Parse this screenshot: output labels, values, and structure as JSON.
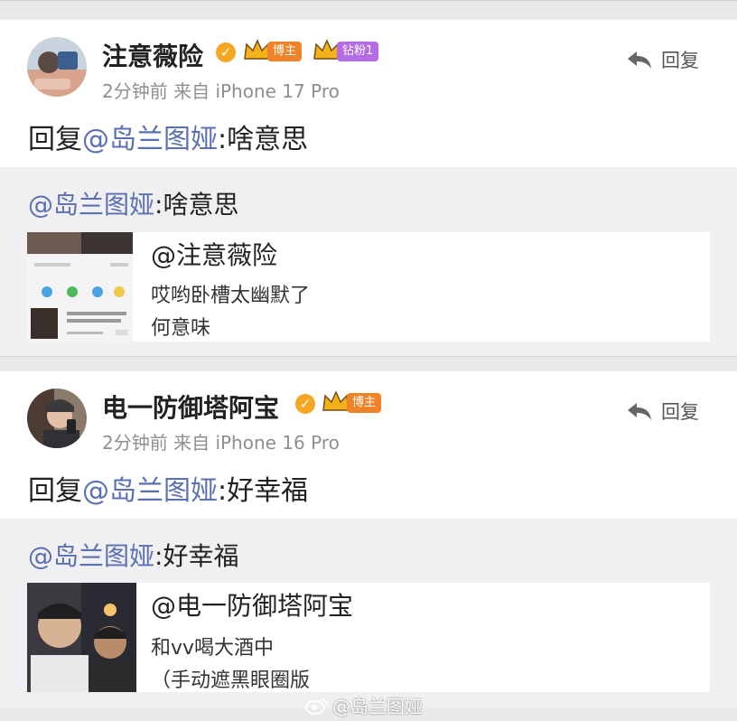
{
  "comments": [
    {
      "username": "注意薇险",
      "badges": [
        "博主",
        "钻粉1"
      ],
      "meta": "2分钟前 来自 iPhone 17 Pro",
      "reply_label": "回复",
      "comment_prefix": "回复",
      "comment_mention": "@岛兰图娅",
      "comment_text": ":啥意思",
      "quote_mention": "@岛兰图娅",
      "quote_text": ":啥意思",
      "original_author": "@注意薇险",
      "original_lines": [
        "哎哟卧槽太幽默了",
        "何意味"
      ]
    },
    {
      "username": "电一防御塔阿宝",
      "badges": [
        "博主"
      ],
      "meta": "2分钟前 来自 iPhone 16 Pro",
      "reply_label": "回复",
      "comment_prefix": "回复",
      "comment_mention": "@岛兰图娅",
      "comment_text": ":好幸福",
      "quote_mention": "@岛兰图娅",
      "quote_text": ":好幸福",
      "original_author": "@电一防御塔阿宝",
      "original_lines": [
        "和vv喝大酒中",
        "（手动遮黑眼圈版"
      ]
    }
  ],
  "watermark": "@岛兰图娅",
  "colors": {
    "mention": "#5b6fb3",
    "badge_orange": "#f0832a",
    "badge_purple": "#b46be4",
    "verified": "#f5a623"
  }
}
